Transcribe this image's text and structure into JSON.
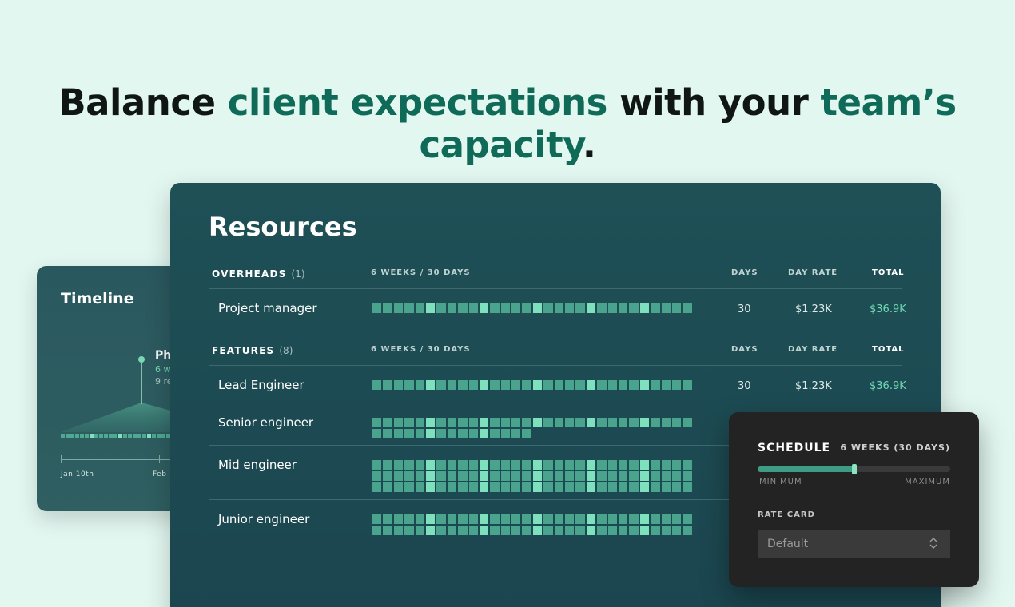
{
  "headline": {
    "part1": "Balance ",
    "accent1": "client expectations",
    "part2": " with your ",
    "accent2": "team’s capacity",
    "part3": "."
  },
  "timeline": {
    "title": "Timeline",
    "phase_title": "Ph",
    "phase_weeks": "6 w",
    "phase_resources": "9 re",
    "axis_labels": [
      "Jan 10th",
      "Feb"
    ]
  },
  "resources": {
    "title": "Resources",
    "overheads": {
      "title": "OVERHEADS",
      "count": "(1)",
      "col_weeks": "6 WEEKS / 30 DAYS",
      "col_days": "DAYS",
      "col_rate": "DAY RATE",
      "col_total": "TOTAL",
      "rows": [
        {
          "name": "Project manager",
          "days": "30",
          "rate": "$1.23K",
          "total": "$36.9K",
          "lines": 1,
          "last_line": 30
        }
      ]
    },
    "features": {
      "title": "FEATURES",
      "count": "(8)",
      "col_weeks": "6 WEEKS / 30 DAYS",
      "col_days": "DAYS",
      "col_rate": "DAY RATE",
      "col_total": "TOTAL",
      "rows": [
        {
          "name": "Lead Engineer",
          "days": "30",
          "rate": "$1.23K",
          "total": "$36.9K",
          "lines": 1,
          "last_line": 30
        },
        {
          "name": "Senior engineer",
          "lines": 2,
          "last_line": 15
        },
        {
          "name": "Mid engineer",
          "lines": 3,
          "last_line": 30
        },
        {
          "name": "Junior engineer",
          "lines": 2,
          "last_line": 30
        }
      ]
    }
  },
  "schedule": {
    "title": "SCHEDULE",
    "duration": "6 WEEKS (30 DAYS)",
    "slider_fraction": 0.5,
    "min_label": "MINIMUM",
    "max_label": "MAXIMUM",
    "rate_card_label": "RATE CARD",
    "rate_card_value": "Default"
  },
  "colors": {
    "accent": "#0f6a58",
    "card_bg": "#1f5056",
    "cell": "#4aa48d",
    "cell_highlight": "#7fe0bd",
    "total": "#6fd9b3"
  }
}
